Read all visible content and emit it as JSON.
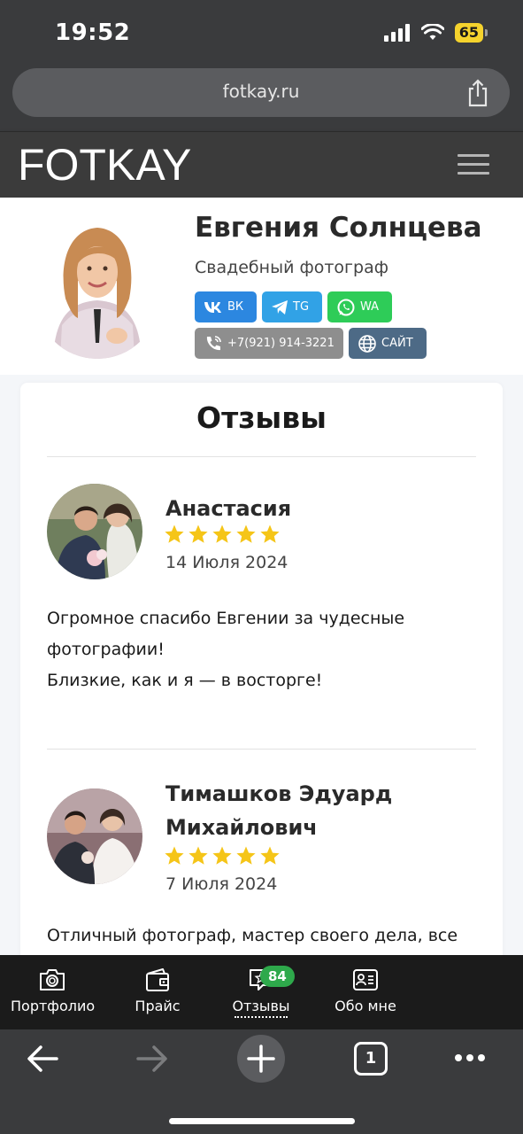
{
  "status_bar": {
    "time": "19:52",
    "battery": "65"
  },
  "address_bar": {
    "url": "fotkay.ru"
  },
  "site_header": {
    "logo": "FOTKAY"
  },
  "profile": {
    "name": "Евгения Солнцева",
    "role": "Свадебный фотограф",
    "buttons": {
      "vk": "ВК",
      "tg": "TG",
      "wa": "WA",
      "phone": "+7(921) 914-3221",
      "site": "САЙТ"
    }
  },
  "reviews": {
    "title": "Отзывы",
    "items": [
      {
        "name": "Анастасия",
        "rating": 5,
        "date": "14 Июля 2024",
        "text_lines": [
          "Огромное спасибо Евгении за чудесные",
          "фотографии!",
          "Близкие, как и я — в восторге!"
        ]
      },
      {
        "name_lines": [
          "Тимашков Эдуард",
          "Михайлович"
        ],
        "rating": 5,
        "date": "7 Июля 2024",
        "text_lines": [
          "Отличный фотограф, мастер своего дела, все"
        ]
      }
    ]
  },
  "site_nav": {
    "items": [
      {
        "label": "Портфолио",
        "icon": "camera-icon"
      },
      {
        "label": "Прайс",
        "icon": "wallet-icon"
      },
      {
        "label": "Отзывы",
        "icon": "review-star-icon",
        "badge": "84",
        "active": true
      },
      {
        "label": "Обо мне",
        "icon": "id-card-icon"
      }
    ]
  },
  "colors": {
    "star": "#f5c518",
    "vk": "#2c87e0",
    "tg": "#31a2e6",
    "wa": "#2ecc58",
    "badge": "#2ea94b"
  },
  "toolbar": {
    "tabs_count": "1"
  }
}
